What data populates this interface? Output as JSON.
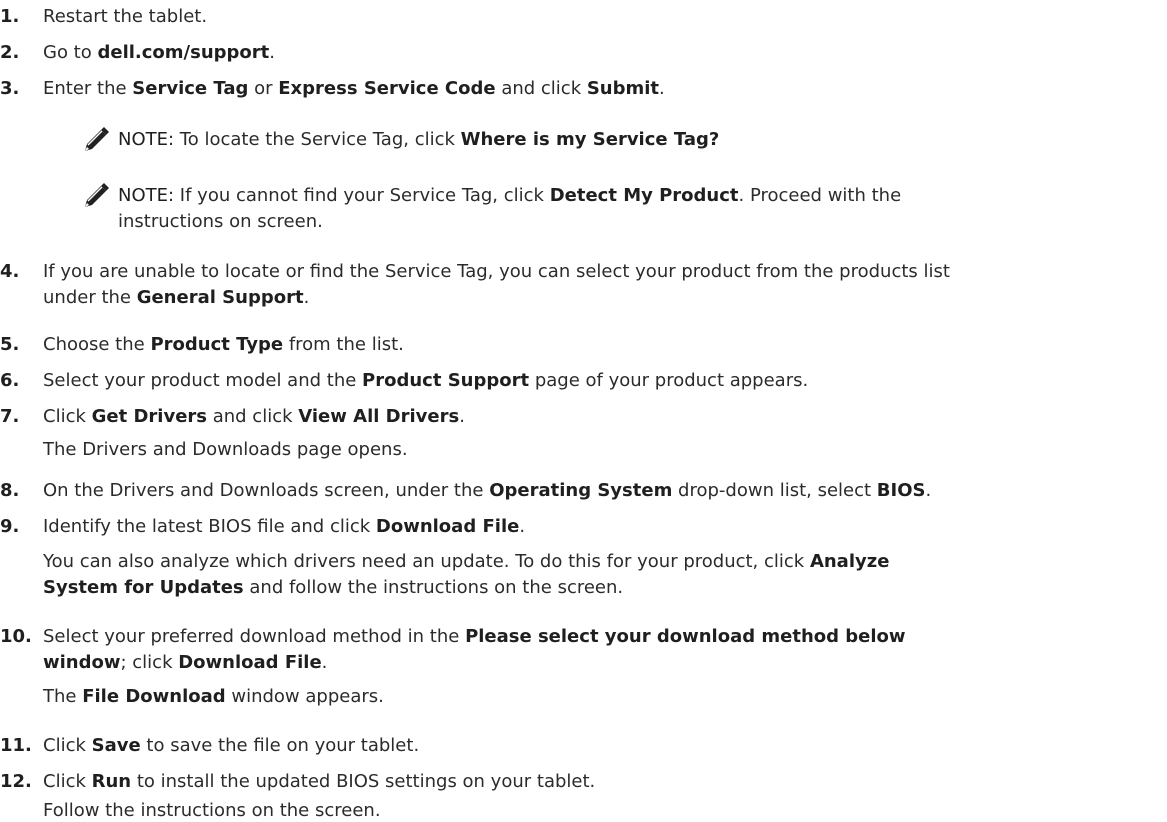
{
  "steps": [
    {
      "number": "1.",
      "parts": [
        {
          "t": "Restart the tablet."
        }
      ]
    },
    {
      "number": "2.",
      "parts": [
        {
          "t": "Go to "
        },
        {
          "t": "dell.com/support",
          "b": true
        },
        {
          "t": "."
        }
      ]
    },
    {
      "number": "3.",
      "parts": [
        {
          "t": "Enter the "
        },
        {
          "t": "Service Tag",
          "b": true
        },
        {
          "t": " or "
        },
        {
          "t": "Express Service Code",
          "b": true
        },
        {
          "t": " and click "
        },
        {
          "t": "Submit",
          "b": true
        },
        {
          "t": "."
        }
      ]
    },
    {
      "number": "4.",
      "lines": [
        [
          {
            "t": "If you are unable to locate or find the Service Tag, you can select your product from the products list"
          }
        ],
        [
          {
            "t": "under the "
          },
          {
            "t": "General Support",
            "b": true
          },
          {
            "t": "."
          }
        ]
      ]
    },
    {
      "number": "5.",
      "parts": [
        {
          "t": "Choose the "
        },
        {
          "t": "Product Type",
          "b": true
        },
        {
          "t": " from the list."
        }
      ]
    },
    {
      "number": "6.",
      "parts": [
        {
          "t": "Select your product model and the "
        },
        {
          "t": "Product Support",
          "b": true
        },
        {
          "t": " page of your product appears."
        }
      ]
    },
    {
      "number": "7.",
      "parts": [
        {
          "t": "Click "
        },
        {
          "t": "Get Drivers",
          "b": true
        },
        {
          "t": " and click "
        },
        {
          "t": "View All Drivers",
          "b": true
        },
        {
          "t": "."
        }
      ]
    },
    {
      "number": "8.",
      "parts": [
        {
          "t": "On the Drivers and Downloads screen, under the "
        },
        {
          "t": "Operating System",
          "b": true
        },
        {
          "t": " drop-down list, select "
        },
        {
          "t": "BIOS",
          "b": true
        },
        {
          "t": "."
        }
      ]
    },
    {
      "number": "9.",
      "parts": [
        {
          "t": "Identify the latest BIOS file and click "
        },
        {
          "t": "Download File",
          "b": true
        },
        {
          "t": "."
        }
      ]
    },
    {
      "number": "10.",
      "lines": [
        [
          {
            "t": "Select your preferred download method in the "
          },
          {
            "t": "Please select your download method below",
            "b": true
          }
        ],
        [
          {
            "t": "window",
            "b": true
          },
          {
            "t": "; click "
          },
          {
            "t": "Download File",
            "b": true
          },
          {
            "t": "."
          }
        ]
      ]
    },
    {
      "number": "11.",
      "parts": [
        {
          "t": "Click "
        },
        {
          "t": "Save",
          "b": true
        },
        {
          "t": " to save the file on your tablet."
        }
      ]
    },
    {
      "number": "12.",
      "parts": [
        {
          "t": "Click "
        },
        {
          "t": "Run",
          "b": true
        },
        {
          "t": " to install the updated BIOS settings on your tablet."
        }
      ]
    }
  ],
  "notes": [
    {
      "lines": [
        [
          {
            "t": "NOTE:",
            "b": false,
            "label": true
          },
          {
            "t": " To locate the Service Tag, click "
          },
          {
            "t": "Where is my Service Tag?",
            "b": true
          }
        ]
      ]
    },
    {
      "lines": [
        [
          {
            "t": "NOTE:",
            "label": true
          },
          {
            "t": " If you cannot find your Service Tag, click "
          },
          {
            "t": "Detect My Product",
            "b": true
          },
          {
            "t": ". Proceed with the"
          }
        ],
        [
          {
            "t": "instructions on screen."
          }
        ]
      ]
    }
  ],
  "subtexts": {
    "s7": [
      {
        "t": "The Drivers and Downloads page opens."
      }
    ],
    "s9a": [
      {
        "t": "You can also analyze which drivers need an update. To do this for your product, click "
      },
      {
        "t": "Analyze",
        "b": true
      }
    ],
    "s9b": [
      {
        "t": "System for Updates",
        "b": true
      },
      {
        "t": " and follow the instructions on the screen."
      }
    ],
    "s10": [
      {
        "t": "The "
      },
      {
        "t": "File Download",
        "b": true
      },
      {
        "t": " window appears."
      }
    ],
    "s12": [
      {
        "t": "Follow the instructions on the screen."
      }
    ]
  },
  "icons": {
    "note": "note-pencil-icon"
  }
}
